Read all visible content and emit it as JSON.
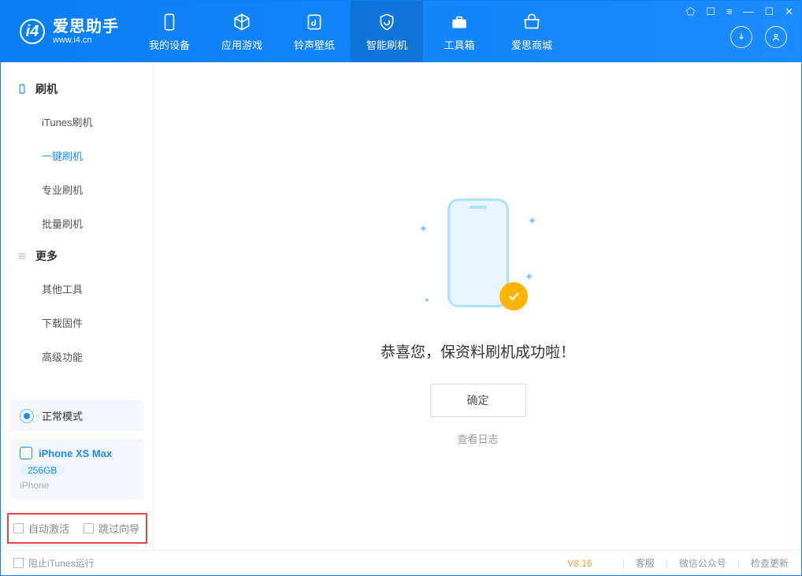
{
  "app": {
    "title": "爱思助手",
    "subtitle": "www.i4.cn"
  },
  "tabs": [
    {
      "label": "我的设备"
    },
    {
      "label": "应用游戏"
    },
    {
      "label": "铃声壁纸"
    },
    {
      "label": "智能刷机"
    },
    {
      "label": "工具箱"
    },
    {
      "label": "爱思商城"
    }
  ],
  "sidebar": {
    "section1": {
      "title": "刷机",
      "items": [
        "iTunes刷机",
        "一键刷机",
        "专业刷机",
        "批量刷机"
      ],
      "active_index": 1
    },
    "section2": {
      "title": "更多",
      "items": [
        "其他工具",
        "下载固件",
        "高级功能"
      ]
    }
  },
  "mode": {
    "label": "正常模式"
  },
  "device": {
    "name": "iPhone XS Max",
    "storage": "256GB",
    "type": "iPhone"
  },
  "options": {
    "auto_activate": "自动激活",
    "skip_guide": "跳过向导"
  },
  "main": {
    "success_text": "恭喜您，保资料刷机成功啦！",
    "ok_button": "确定",
    "view_log": "查看日志"
  },
  "footer": {
    "block_itunes": "阻止iTunes运行",
    "version": "V8.16",
    "links": [
      "客服",
      "微信公众号",
      "检查更新"
    ]
  }
}
